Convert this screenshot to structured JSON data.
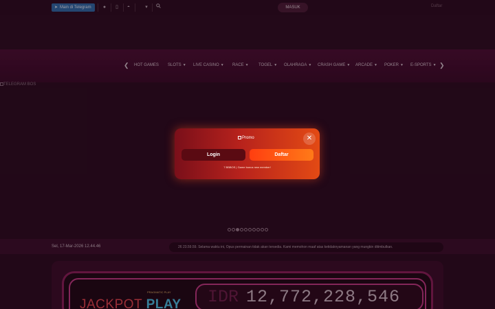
{
  "topbar": {
    "telegram_button": "Main di Telegram",
    "telegram_icon": "send-icon",
    "chat_icon": "chat-icon",
    "mobile_icon": "mobile-icon",
    "android_icon": "android-icon",
    "language_dropdown_icon": "chevron-down-icon",
    "search_icon": "search-icon",
    "login_button": "MASUK",
    "register_link": "Daftar"
  },
  "nav": {
    "items": [
      {
        "label": "HOT GAMES",
        "has_dropdown": false
      },
      {
        "label": "SLOTS",
        "has_dropdown": true
      },
      {
        "label": "LIVE CASINO",
        "has_dropdown": true
      },
      {
        "label": "RACE",
        "has_dropdown": true
      },
      {
        "label": "TOGEL",
        "has_dropdown": true
      },
      {
        "label": "OLAHRAGA",
        "has_dropdown": true
      },
      {
        "label": "CRASH GAME",
        "has_dropdown": true
      },
      {
        "label": "ARCADE",
        "has_dropdown": true
      },
      {
        "label": "POKER",
        "has_dropdown": true
      },
      {
        "label": "E-SPORTS",
        "has_dropdown": true
      }
    ],
    "chevron_glyph": "❯"
  },
  "banner": {
    "alt_text": "TELEGRAM BOS",
    "slide_count": 10,
    "active_slide": 3
  },
  "ticker": {
    "datetime": "Sel, 17-Mar-2026 12.44.46",
    "message": "26 23.59.59. Selama waktu ini, Opus permainan tidak akan tersedia. Kami memohon maaf atas ketidaknyamanan yang mungkin ditimbulkan."
  },
  "jackpot": {
    "provider": "PRAGMATIC PLAY",
    "label_left": "JACKPOT",
    "label_right": "PLAY",
    "currency": "IDR",
    "amount": "12,772,228,546"
  },
  "modal": {
    "image_alt": "Promo",
    "close_glyph": "✕",
    "login_button": "Login",
    "register_button": "Daftar",
    "note": "7 BBBOS | Game bonus new member!"
  },
  "colors": {
    "background": "#2a0c1f",
    "navbar": "#4a0f33",
    "modal_start": "#7a0f1a",
    "modal_end": "#e34a14",
    "register_accent": "#ff5a14",
    "jackpot_pink": "#c23a84"
  }
}
